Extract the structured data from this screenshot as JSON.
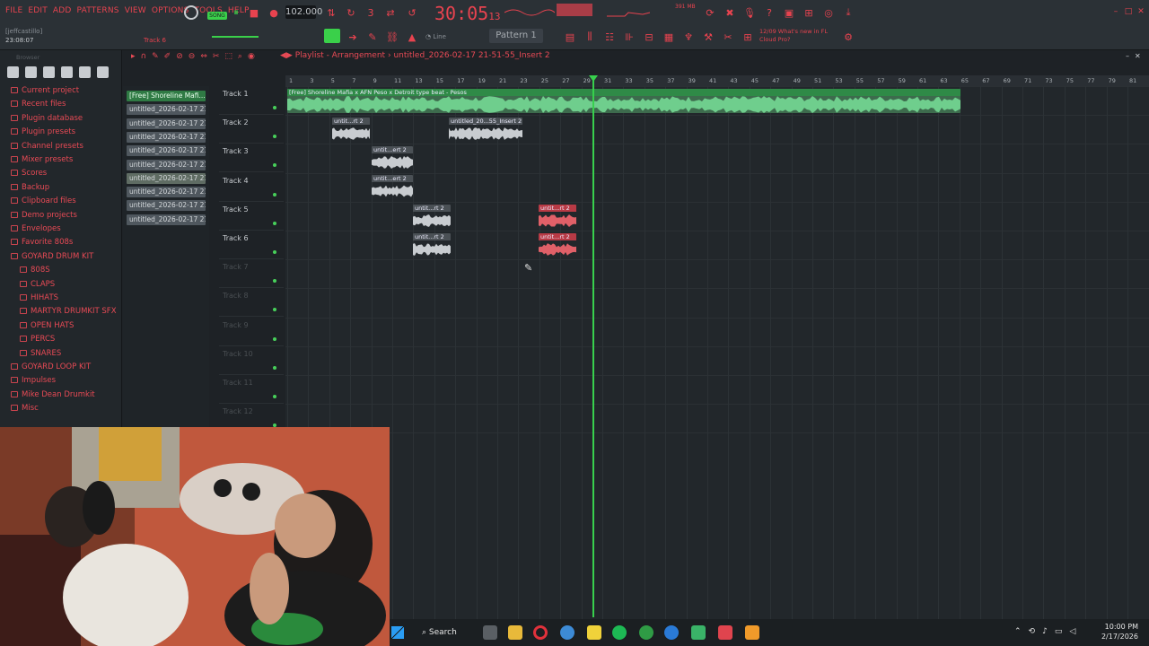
{
  "menu": [
    "FILE",
    "EDIT",
    "ADD",
    "PATTERNS",
    "VIEW",
    "OPTIONS",
    "TOOLS",
    "HELP"
  ],
  "transport": {
    "pat_song": "SONG",
    "tempo": "102.000",
    "time": "30:05",
    "time_small": "13"
  },
  "hint": {
    "user": "[jeffcastillo]",
    "time": "23:08:07",
    "track": "Track 6"
  },
  "pattern_selector": "Pattern 1",
  "news": {
    "line1": "12/09  What's new in FL",
    "line2": "Cloud Pro?"
  },
  "cpu_mem": "391 MB",
  "browser": {
    "title": "Browser",
    "items": [
      "Current project",
      "Recent files",
      "Plugin database",
      "Plugin presets",
      "Channel presets",
      "Mixer presets",
      "Scores",
      "Backup",
      "Clipboard files",
      "Demo projects",
      "Envelopes",
      "Favorite 808s",
      "GOYARD DRUM KIT",
      "808S",
      "CLAPS",
      "HIHATS",
      "MARTYR DRUMKIT SFX",
      "OPEN HATS",
      "PERCS",
      "SNARES",
      "GOYARD LOOP KIT",
      "Impulses",
      "Mike Dean Drumkit",
      "Misc"
    ]
  },
  "playlist": {
    "title": "Playlist - Arrangement",
    "crumb": "untitled_2026-02-17 21-51-55_Insert 2",
    "ruler": [
      "1",
      "3",
      "5",
      "7",
      "9",
      "11",
      "13",
      "15",
      "17",
      "19",
      "21",
      "23",
      "25",
      "27",
      "29",
      "31",
      "33",
      "35",
      "37",
      "39",
      "41",
      "43",
      "45",
      "47",
      "49",
      "51",
      "53",
      "55",
      "57",
      "59",
      "61",
      "63",
      "65",
      "67",
      "69",
      "71",
      "73",
      "75",
      "77",
      "79",
      "81"
    ],
    "tracks": [
      "Track 1",
      "Track 2",
      "Track 3",
      "Track 4",
      "Track 5",
      "Track 6",
      "Track 7",
      "Track 8",
      "Track 9",
      "Track 10",
      "Track 11",
      "Track 12"
    ],
    "clips": {
      "main": "[Free] Shoreline Mafia x AFN Peso x Detroit type beat - Pesos",
      "c2a": "untit...rt 2",
      "c2b": "untitled_20...55_Insert 2",
      "c3": "untit...ert 2",
      "c4": "untit...ert 2",
      "c5a": "untit...rt 2",
      "c5b": "untit...rt 2",
      "c6a": "untit...rt 2",
      "c6b": "untit...rt 2"
    }
  },
  "picker": [
    "[Free] Shoreline Mafi...",
    "untitled_2026-02-17 21-...",
    "untitled_2026-02-17 21-...",
    "untitled_2026-02-17 21-...",
    "untitled_2026-02-17 21-...",
    "untitled_2026-02-17 21-...",
    "untitled_2026-02-17 21-...",
    "untitled_2026-02-17 21-...",
    "untitled_2026-02-17 21-...",
    "untitled_2026-02-17 21-..."
  ],
  "taskbar": {
    "search": "Search",
    "time": "10:00 PM",
    "date": "2/17/2026"
  },
  "colors": {
    "accent": "#e8434f",
    "green": "#38d04d",
    "audio_green": "#6fce8d",
    "audio_red": "#c9414c"
  }
}
